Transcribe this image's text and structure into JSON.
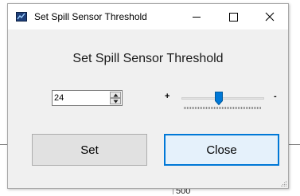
{
  "window": {
    "title": "Set Spill Sensor Threshold",
    "icon": "app-icon"
  },
  "titlebar_buttons": {
    "minimize_icon": "minimize-icon",
    "maximize_icon": "maximize-icon",
    "close_icon": "close-icon"
  },
  "dialog": {
    "heading": "Set Spill Sensor Threshold",
    "threshold_value": "24",
    "slider": {
      "plus_label": "+",
      "minus_label": "-",
      "position_fraction": 0.45
    },
    "set_label": "Set",
    "close_label": "Close"
  },
  "background": {
    "partial_text": "500"
  },
  "colors": {
    "accent": "#0078d7",
    "window_bg": "#f0f0f0",
    "button_bg": "#e1e1e1",
    "focused_button_bg": "#e5f1fb"
  }
}
